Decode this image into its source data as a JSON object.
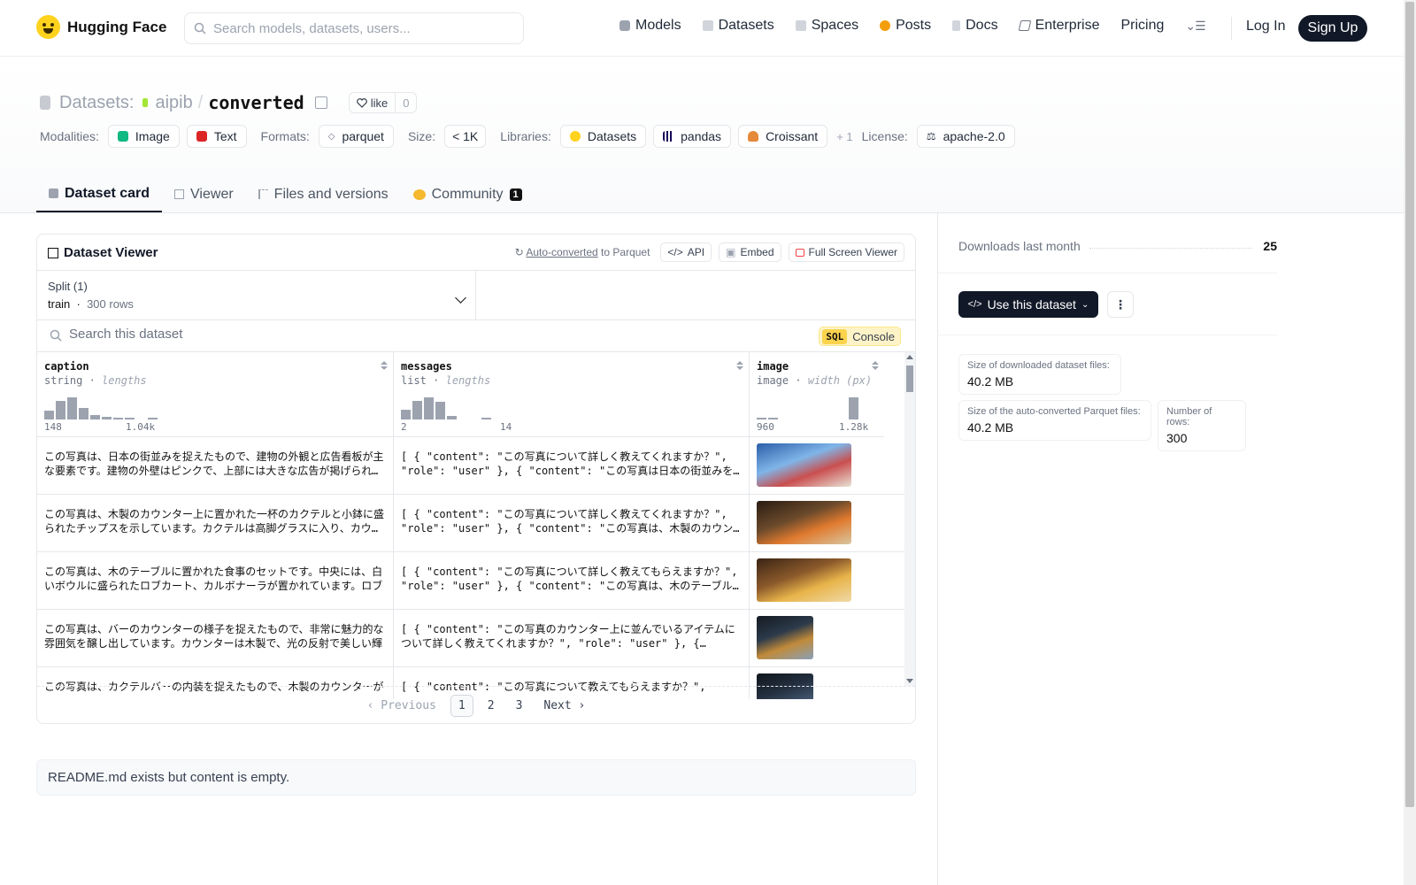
{
  "header": {
    "brand": "Hugging Face",
    "search_placeholder": "Search models, datasets, users...",
    "nav": [
      {
        "label": "Models",
        "color": "#6b7280"
      },
      {
        "label": "Datasets",
        "color": "#9ca3af"
      },
      {
        "label": "Spaces",
        "color": "#9ca3af"
      },
      {
        "label": "Posts",
        "color": "#f59e0b"
      },
      {
        "label": "Docs",
        "color": "#9ca3af"
      },
      {
        "label": "Enterprise",
        "color": "#6b7280"
      },
      {
        "label": "Pricing",
        "color": ""
      }
    ],
    "login": "Log In",
    "signup": "Sign Up"
  },
  "repo": {
    "section": "Datasets:",
    "org": "aipib",
    "slash": "/",
    "name": "converted",
    "like_label": "like",
    "like_count": "0"
  },
  "tags": {
    "modalities_label": "Modalities:",
    "modalities": [
      "Image",
      "Text"
    ],
    "formats_label": "Formats:",
    "formats": [
      "parquet"
    ],
    "size_label": "Size:",
    "size": "< 1K",
    "libraries_label": "Libraries:",
    "libraries": [
      "Datasets",
      "pandas",
      "Croissant"
    ],
    "libraries_more": "+ 1",
    "license_label": "License:",
    "license": "apache-2.0"
  },
  "tabs": [
    {
      "label": "Dataset card",
      "active": true
    },
    {
      "label": "Viewer"
    },
    {
      "label": "Files and versions"
    },
    {
      "label": "Community",
      "badge": "1"
    }
  ],
  "viewer": {
    "title": "Dataset Viewer",
    "auto_converted": "Auto-converted",
    "to_parquet": "to Parquet",
    "api": "API",
    "embed": "Embed",
    "fullscreen": "Full Screen Viewer",
    "split_label": "Split (1)",
    "split_name": "train",
    "split_rows": "300 rows",
    "search_placeholder": "Search this dataset",
    "sql_tag": "SQL",
    "sql_label": "Console",
    "columns": [
      {
        "name": "caption",
        "type": "string",
        "stat": "lengths",
        "min": "148",
        "max": "1.04k",
        "hist": [
          0.35,
          0.75,
          0.9,
          0.45,
          0.18,
          0.1,
          0.05,
          0.04,
          0.0,
          0.03
        ]
      },
      {
        "name": "messages",
        "type": "list",
        "stat": "lengths",
        "min": "2",
        "max": "14",
        "hist": [
          0.4,
          0.75,
          0.9,
          0.7,
          0.15,
          0.0,
          0.0,
          0.04
        ]
      },
      {
        "name": "image",
        "type": "image",
        "stat": "width (px)",
        "min": "960",
        "max": "1.28k",
        "hist": [
          0.04,
          0.04,
          0,
          0,
          0,
          0,
          0,
          0,
          0.9
        ]
      }
    ],
    "rows": [
      {
        "caption": "この写真は、日本の街並みを捉えたもので、建物の外観と広告看板が主な要素です。建物の外壁はピンクで、上部には大きな広告が掲げられています。",
        "messages": "[ { \"content\": \"この写真について詳しく教えてくれますか？\", \"role\": \"user\" }, { \"content\": \"この写真は日本の街並みを捉えたもので、",
        "image_colors": [
          "#2b5ea8",
          "#7fb5e8",
          "#e8e2d6",
          "#c94f4f"
        ]
      },
      {
        "caption": "この写真は、木製のカウンター上に置かれた一杯のカクテルと小鉢に盛られたチップスを示しています。カクテルは高脚グラスに入り、カウンター",
        "messages": "[ { \"content\": \"この写真について詳しく教えてくれますか？\", \"role\": \"user\" }, { \"content\": \"この写真は、木製のカウンター上",
        "image_colors": [
          "#2a1c12",
          "#6b4a2b",
          "#d9c7a0",
          "#e07a2f"
        ]
      },
      {
        "caption": "この写真は、木のテーブルに置かれた食事のセットです。中央には、白いボウルに盛られたロブカート、カルボナーラが置かれています。ロブ",
        "messages": "[ { \"content\": \"この写真について詳しく教えてもらえますか？\", \"role\": \"user\" }, { \"content\": \"この写真は、木のテーブルに置",
        "image_colors": [
          "#3a2414",
          "#8c5a2b",
          "#f0d9a8",
          "#e8b44a"
        ]
      },
      {
        "caption": "この写真は、バーのカウンターの様子を捉えたもので、非常に魅力的な雰囲気を醸し出しています。カウンターは木製で、光の反射で美しい輝",
        "messages": "[ { \"content\": \"この写真のカウンター上に並んでいるアイテムについて詳しく教えてくれますか？\", \"role\": \"user\" }, {…",
        "image_colors": [
          "#141a22",
          "#2c3a4a",
          "#8aa0b8",
          "#c08a3a"
        ]
      },
      {
        "caption": "この写真は、カクテルバーの内装を捉えたもので、木製のカウンターが",
        "messages": "[ { \"content\": \"この写真について教えてもらえますか？\",",
        "image_colors": [
          "#10151c",
          "#243040",
          "#6f8aa8",
          "#3d4f66"
        ]
      }
    ],
    "pagination": {
      "prev": "Previous",
      "pages": [
        "1",
        "2",
        "3"
      ],
      "current": "1",
      "next": "Next"
    }
  },
  "readme": "README.md exists but content is empty.",
  "sidebar": {
    "downloads_label": "Downloads last month",
    "downloads": "25",
    "use_dataset": "Use this dataset",
    "size_downloaded_label": "Size of downloaded dataset files:",
    "size_downloaded": "40.2 MB",
    "size_parquet_label": "Size of the auto-converted Parquet files:",
    "size_parquet": "40.2 MB",
    "num_rows_label": "Number of rows:",
    "num_rows": "300"
  }
}
